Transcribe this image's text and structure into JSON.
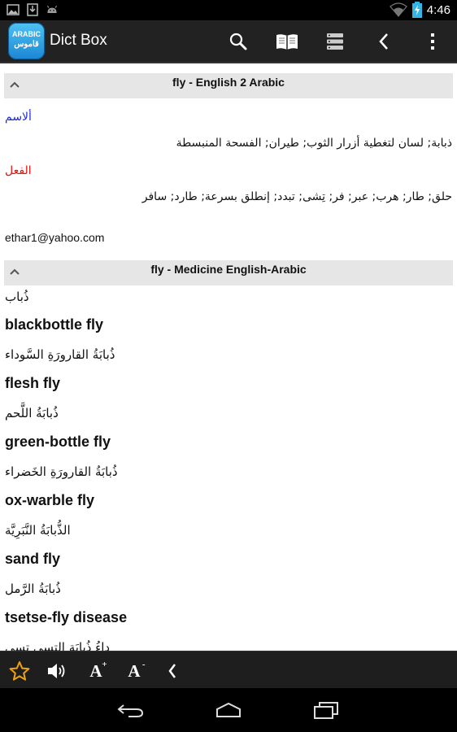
{
  "status_bar": {
    "time": "4:46"
  },
  "action_bar": {
    "logo_top": "ARABIC",
    "logo_bottom": "قاموس",
    "title": "Dict Box"
  },
  "entries": [
    {
      "header": "fly - English 2 Arabic",
      "noun_label": "ألاسم",
      "noun_text": "ذبابة; لسان لتغطية أزرار الثوب; طيران; الفسحة المنبسطة",
      "verb_label": "الفعل",
      "verb_text": "حلق; طار; هرب; عبر; فر; تِشى; تبدد; إنطلق بسرعة; طارد; سافر",
      "contributor": "ethar1@yahoo.com"
    },
    {
      "header": "fly - Medicine English-Arabic",
      "translation": "ذُباب",
      "items": [
        {
          "term": "blackbottle fly",
          "arabic": "ذُبابَةُ القارورَةِ السَّوداء"
        },
        {
          "term": "flesh fly",
          "arabic": "ذُبابَةُ اللَّحم"
        },
        {
          "term": "green-bottle fly",
          "arabic": "ذُبابَةُ القارورَةِ الخَضراء"
        },
        {
          "term": "ox-warble fly",
          "arabic": "الذُّبابَةُ النَّبَرِيَّة"
        },
        {
          "term": "sand fly",
          "arabic": "ذُبابَةُ الرَّمل"
        },
        {
          "term": "tsetse-fly disease",
          "arabic": "داءُ ذُبابَةِ التسي تسي"
        }
      ]
    }
  ],
  "icons": {
    "favorite": "star-outline-icon",
    "sound": "speaker-icon",
    "font_up": "font-increase-icon",
    "font_down": "font-decrease-icon",
    "accent": "#f0a30a"
  }
}
